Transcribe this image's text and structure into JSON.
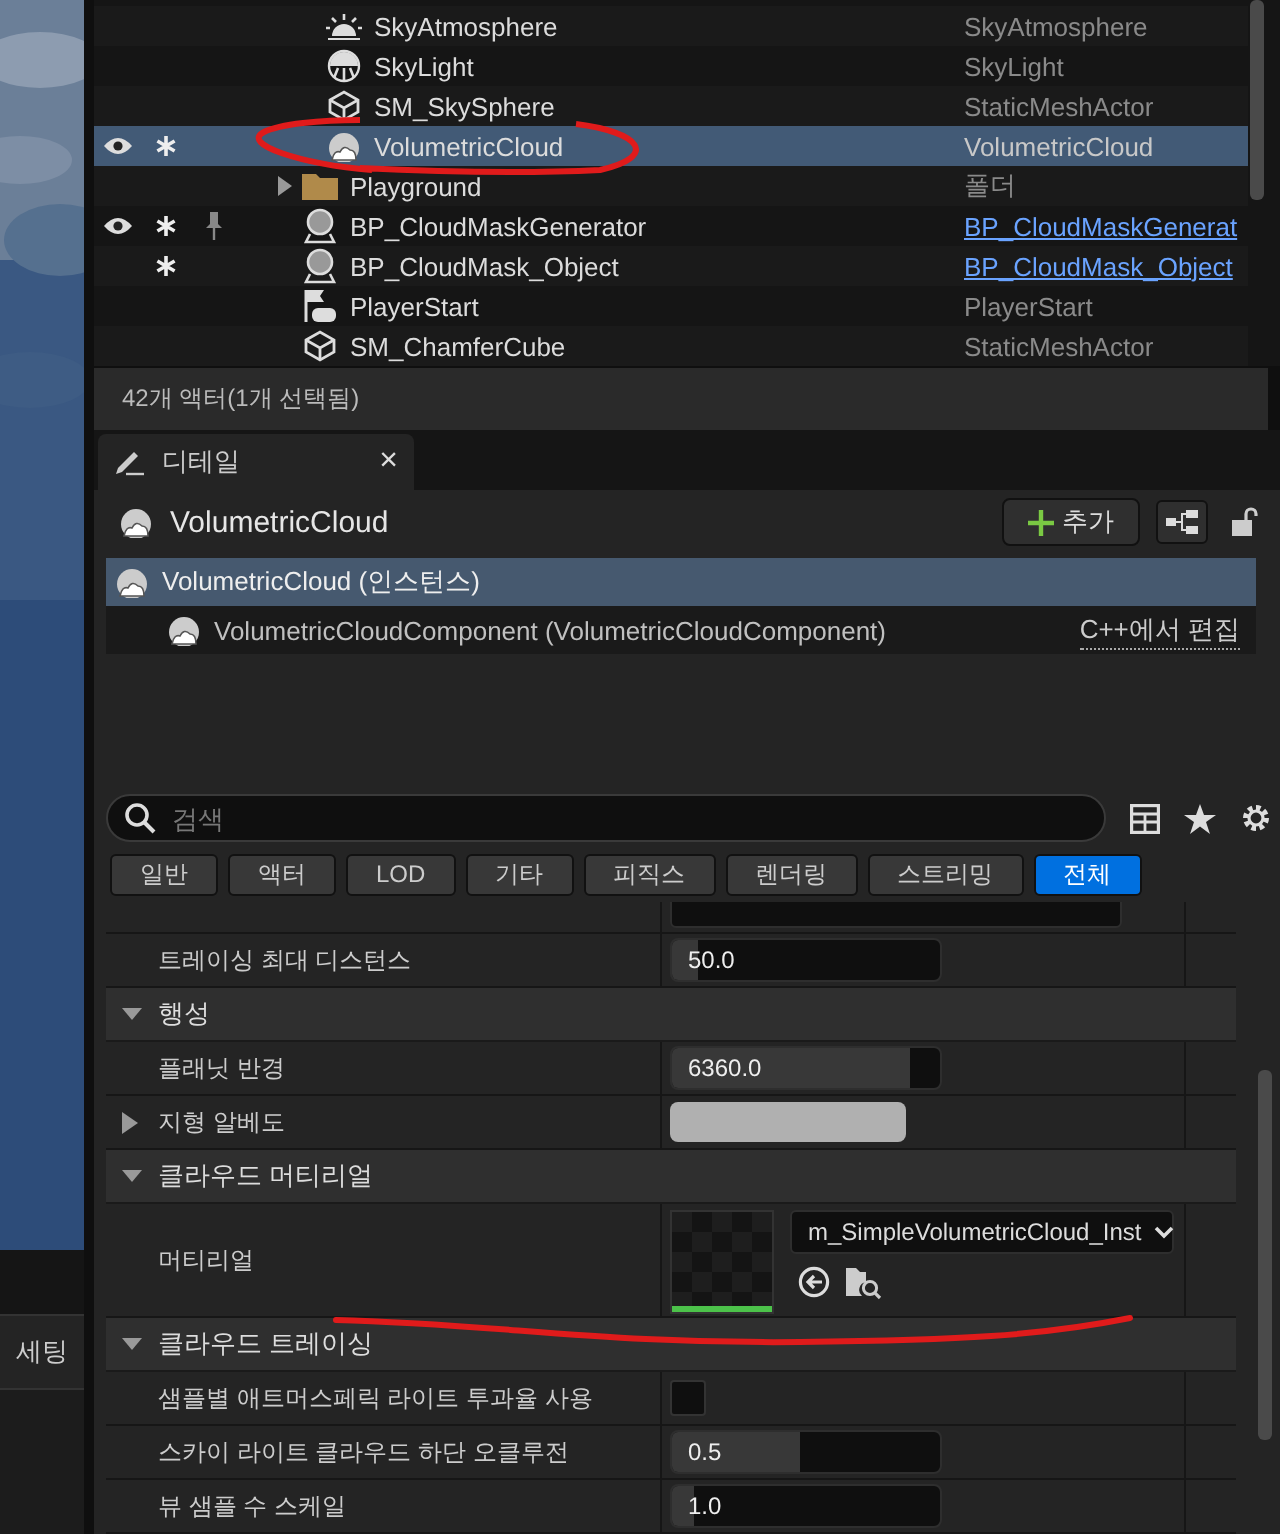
{
  "side_tab": {
    "label": "세팅"
  },
  "outliner": {
    "rows": [
      {
        "label": "SkyAtmosphere",
        "type": "SkyAtmosphere",
        "kind": "atmosphere",
        "in_folder": true,
        "selected": false,
        "visible": false,
        "starred": false,
        "pinned": false,
        "type_link": false,
        "expandable": false
      },
      {
        "label": "SkyLight",
        "type": "SkyLight",
        "kind": "skylight",
        "in_folder": true,
        "selected": false,
        "visible": false,
        "starred": false,
        "pinned": false,
        "type_link": false,
        "expandable": false
      },
      {
        "label": "SM_SkySphere",
        "type": "StaticMeshActor",
        "kind": "mesh",
        "in_folder": true,
        "selected": false,
        "visible": false,
        "starred": false,
        "pinned": false,
        "type_link": false,
        "expandable": false
      },
      {
        "label": "VolumetricCloud",
        "type": "VolumetricCloud",
        "kind": "cloud",
        "in_folder": true,
        "selected": true,
        "visible": true,
        "starred": true,
        "pinned": false,
        "type_link": false,
        "expandable": false
      },
      {
        "label": "Playground",
        "type": "폴더",
        "kind": "folder",
        "in_folder": false,
        "selected": false,
        "visible": false,
        "starred": false,
        "pinned": false,
        "type_link": false,
        "expandable": true
      },
      {
        "label": "BP_CloudMaskGenerator",
        "type": "BP_CloudMaskGenerat",
        "kind": "blueprint",
        "in_folder": false,
        "selected": false,
        "visible": true,
        "starred": true,
        "pinned": true,
        "type_link": true,
        "expandable": false
      },
      {
        "label": "BP_CloudMask_Object",
        "type": "BP_CloudMask_Object",
        "kind": "blueprint",
        "in_folder": false,
        "selected": false,
        "visible": false,
        "starred": true,
        "pinned": false,
        "type_link": true,
        "expandable": false
      },
      {
        "label": "PlayerStart",
        "type": "PlayerStart",
        "kind": "player",
        "in_folder": false,
        "selected": false,
        "visible": false,
        "starred": false,
        "pinned": false,
        "type_link": false,
        "expandable": false
      },
      {
        "label": "SM_ChamferCube",
        "type": "StaticMeshActor",
        "kind": "mesh",
        "in_folder": false,
        "selected": false,
        "visible": false,
        "starred": false,
        "pinned": false,
        "type_link": false,
        "expandable": false
      }
    ],
    "status": "42개 액터(1개 선택됨)"
  },
  "details": {
    "tab": {
      "label": "디테일",
      "close": "×"
    },
    "title": "VolumetricCloud",
    "add_button": "추가",
    "components": [
      {
        "label": "VolumetricCloud (인스턴스)",
        "selected": true
      },
      {
        "label": "VolumetricCloudComponent (VolumetricCloudComponent)",
        "selected": false,
        "link": "C++에서 편집"
      }
    ],
    "search": {
      "placeholder": "검색"
    },
    "filters": [
      {
        "label": "일반",
        "selected": false
      },
      {
        "label": "액터",
        "selected": false
      },
      {
        "label": "LOD",
        "selected": false
      },
      {
        "label": "기타",
        "selected": false
      },
      {
        "label": "피직스",
        "selected": false
      },
      {
        "label": "렌더링",
        "selected": false
      },
      {
        "label": "스트리밍",
        "selected": false
      },
      {
        "label": "전체",
        "selected": true
      }
    ],
    "properties": [
      {
        "kind": "cut_dropdown"
      },
      {
        "kind": "number",
        "label": "트레이싱 최대 디스턴스",
        "value": "50.0",
        "level": 0.1
      },
      {
        "kind": "category",
        "label": "행성",
        "expanded": true
      },
      {
        "kind": "number",
        "label": "플래닛 반경",
        "value": "6360.0",
        "level": 0.89
      },
      {
        "kind": "color",
        "label": "지형 알베도",
        "color": "#b0b0b0",
        "expanded": false
      },
      {
        "kind": "category",
        "label": "클라우드 머티리얼",
        "expanded": true
      },
      {
        "kind": "material",
        "label": "머티리얼",
        "value": "m_SimpleVolumetricCloud_Inst"
      },
      {
        "kind": "category",
        "label": "클라우드 트레이싱",
        "expanded": true
      },
      {
        "kind": "checkbox",
        "label": "샘플별 애트머스페릭 라이트 투과율 사용",
        "checked": false
      },
      {
        "kind": "number",
        "label": "스카이 라이트 클라우드 하단 오클루전",
        "value": "0.5",
        "level": 0.48
      },
      {
        "kind": "number",
        "label": "뷰 샘플 수 스케일",
        "value": "1.0",
        "level": 0.08
      }
    ]
  }
}
